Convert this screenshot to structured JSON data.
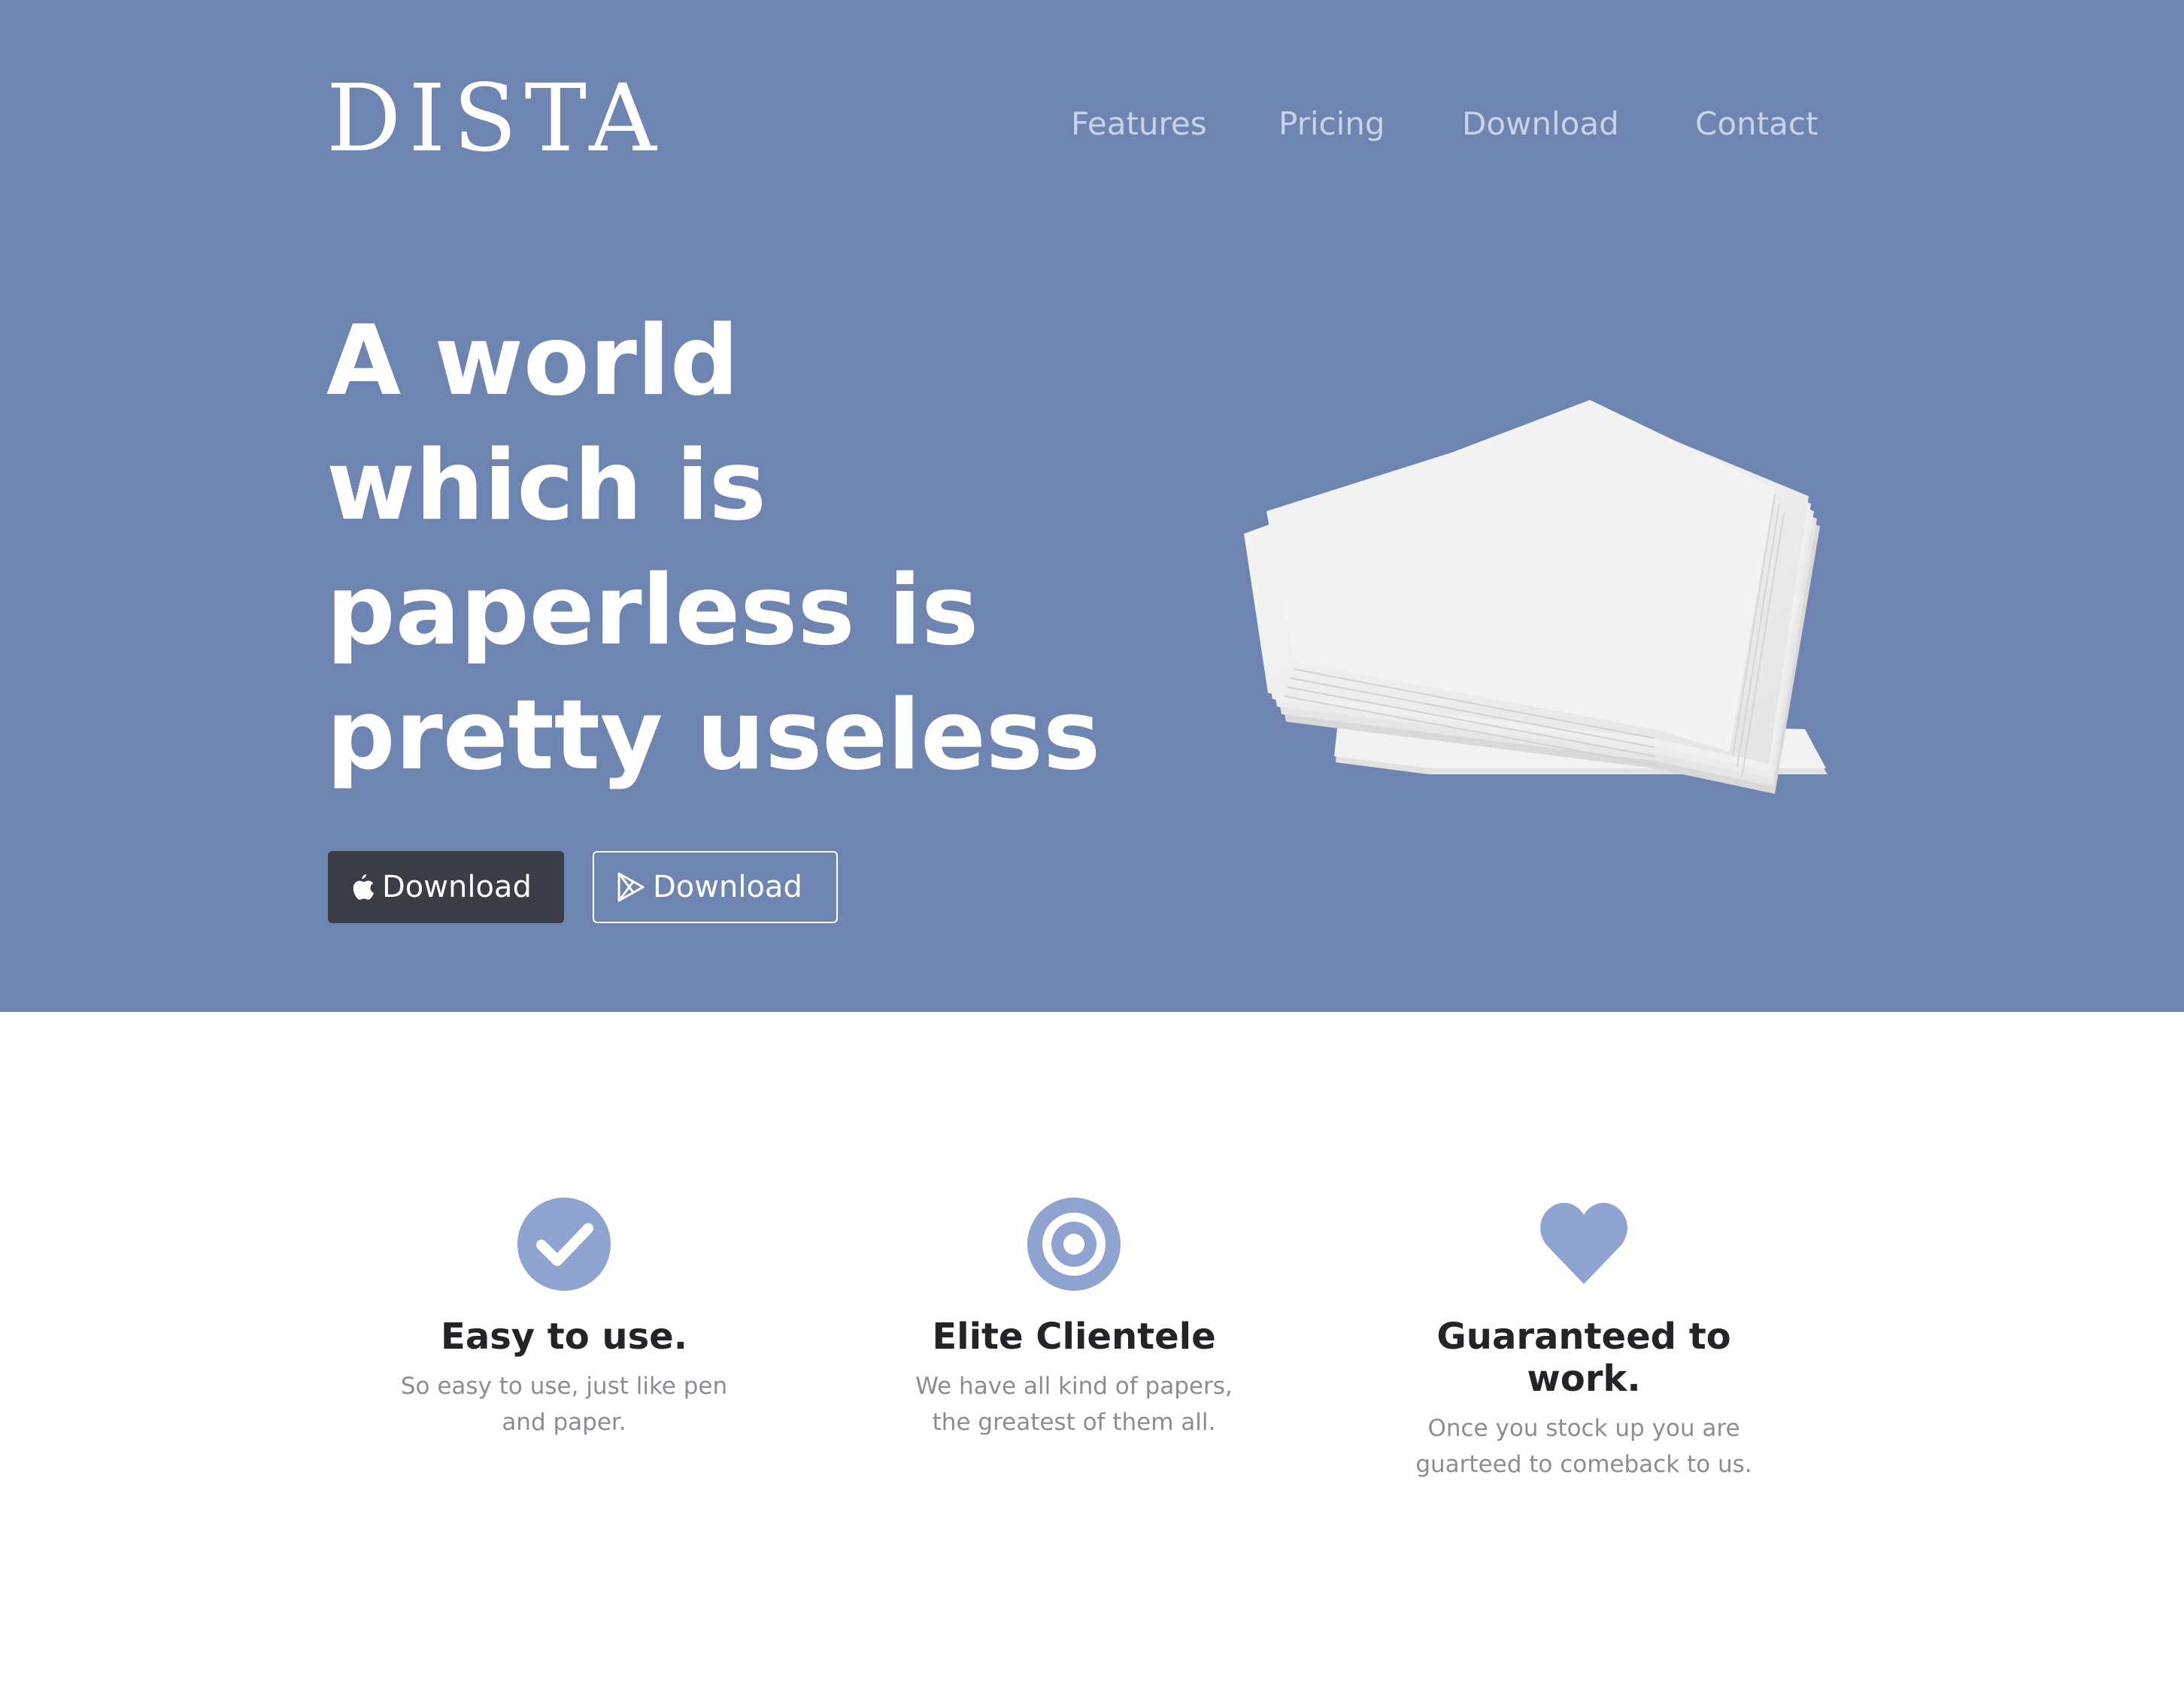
{
  "colors": {
    "hero_background": "#6e85b2",
    "nav_text": "#c8d3ea",
    "dark_button": "#3a3d46",
    "feature_icon": "#8fa3d1",
    "heading_text": "#222428",
    "muted_text": "#8a8d92"
  },
  "header": {
    "logo": "DISTA",
    "nav": [
      {
        "label": "Features"
      },
      {
        "label": "Pricing"
      },
      {
        "label": "Download"
      },
      {
        "label": "Contact"
      }
    ]
  },
  "hero": {
    "headline_lines": [
      "A world",
      "which is",
      "paperless is",
      "pretty useless"
    ],
    "buttons": [
      {
        "label": "Download",
        "icon": "apple-icon"
      },
      {
        "label": "Download",
        "icon": "google-play-icon"
      }
    ],
    "image": "paper-stack-image"
  },
  "features": [
    {
      "icon": "check-circle-icon",
      "title": "Easy to use.",
      "text": "So easy to use, just like pen and paper."
    },
    {
      "icon": "target-icon",
      "title": "Elite Clientele",
      "text": "We have all kind of papers, the greatest of them all."
    },
    {
      "icon": "heart-icon",
      "title": "Guaranteed to work.",
      "text": "Once you stock up you are guarteed to comeback to us."
    }
  ]
}
